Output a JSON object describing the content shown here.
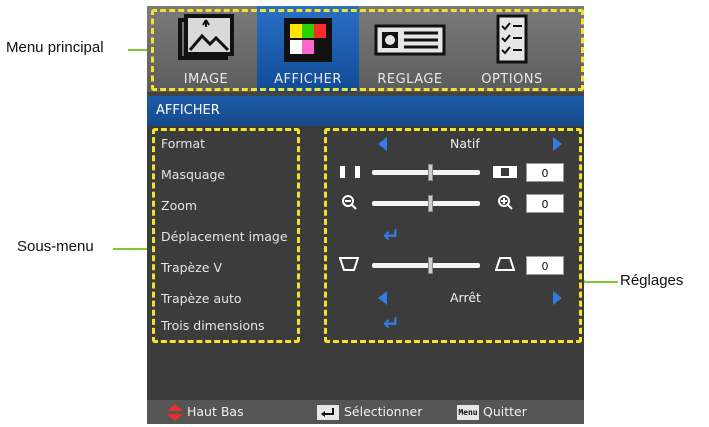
{
  "callouts": {
    "main_menu": "Menu principal",
    "sub_menu": "Sous-menu",
    "settings": "Réglages"
  },
  "tabs": [
    {
      "label": "IMAGE",
      "icon": "image-icon",
      "active": false
    },
    {
      "label": "AFFICHER",
      "icon": "display-icon",
      "active": true
    },
    {
      "label": "REGLAGE",
      "icon": "projector-icon",
      "active": false
    },
    {
      "label": "OPTIONS",
      "icon": "checklist-icon",
      "active": false
    }
  ],
  "section_title": "AFFICHER",
  "menu_items": [
    {
      "label": "Format",
      "value": "Natif",
      "type": "select"
    },
    {
      "label": "Masquage",
      "value": "0",
      "type": "slider"
    },
    {
      "label": "Zoom",
      "value": "0",
      "type": "slider"
    },
    {
      "label": "Déplacement image",
      "type": "enter"
    },
    {
      "label": "Trapèze V",
      "value": "0",
      "type": "slider"
    },
    {
      "label": "Trapèze auto",
      "value": "Arrêt",
      "type": "select"
    },
    {
      "label": "Trois dimensions",
      "type": "enter"
    }
  ],
  "footer": {
    "nav": "Haut Bas",
    "select": "Sélectionner",
    "menu_key": "Menu",
    "quit": "Quitter"
  },
  "colors": {
    "accent_blue": "#2f7de0",
    "callout_green": "#7ec832",
    "dash_yellow": "#f2e229"
  }
}
